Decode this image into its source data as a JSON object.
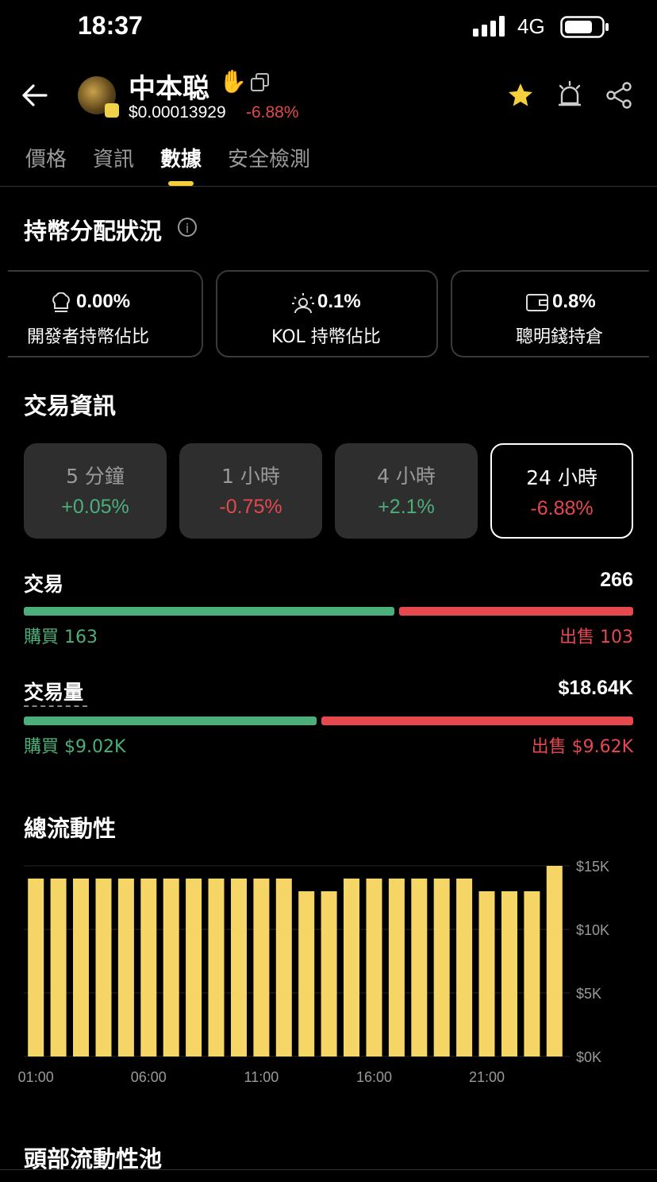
{
  "status_bar": {
    "time": "18:37",
    "network": "4G"
  },
  "header": {
    "token_name": "中本聪",
    "price": "$0.00013929",
    "change": "-6.88%"
  },
  "tabs": [
    {
      "label": "價格"
    },
    {
      "label": "資訊"
    },
    {
      "label": "數據",
      "active": true
    },
    {
      "label": "安全檢測"
    }
  ],
  "holdings": {
    "title": "持幣分配狀況",
    "cards": [
      {
        "icon": "chef-hat-icon",
        "value": "0.00%",
        "label": "開發者持幣佔比"
      },
      {
        "icon": "sun-person-icon",
        "value": "0.1%",
        "label": "KOL 持幣佔比"
      },
      {
        "icon": "wallet-icon",
        "value": "0.8%",
        "label": "聰明錢持倉"
      }
    ]
  },
  "trading": {
    "title": "交易資訊",
    "timeframes": [
      {
        "name": "5 分鐘",
        "value": "+0.05%",
        "dir": "up"
      },
      {
        "name": "1 小時",
        "value": "-0.75%",
        "dir": "down"
      },
      {
        "name": "4 小時",
        "value": "+2.1%",
        "dir": "up"
      },
      {
        "name": "24 小時",
        "value": "-6.88%",
        "dir": "down",
        "selected": true
      }
    ],
    "txns": {
      "label": "交易",
      "total": "266",
      "buy_label": "購買 163",
      "sell_label": "出售 103",
      "buy": 163,
      "sell": 103
    },
    "volume": {
      "label": "交易量",
      "total": "$18.64K",
      "buy_label": "購買 $9.02K",
      "sell_label": "出售 $9.62K",
      "buy": 9.02,
      "sell": 9.62
    }
  },
  "liquidity": {
    "title": "總流動性"
  },
  "top_pools": {
    "title": "頭部流動性池"
  },
  "colors": {
    "accent": "#f5cf3b",
    "green": "#4caf7a",
    "red": "#e5484d",
    "bar": "#f5d565"
  },
  "chart_data": {
    "type": "bar",
    "title": "",
    "x": [
      "01:00",
      "02:00",
      "03:00",
      "04:00",
      "05:00",
      "06:00",
      "07:00",
      "08:00",
      "09:00",
      "10:00",
      "11:00",
      "12:00",
      "13:00",
      "14:00",
      "15:00",
      "16:00",
      "17:00",
      "18:00",
      "19:00",
      "20:00",
      "21:00",
      "22:00",
      "23:00",
      "00:00"
    ],
    "x_tick_labels": [
      "01:00",
      "06:00",
      "11:00",
      "16:00",
      "21:00"
    ],
    "values": [
      14000,
      14000,
      14000,
      14000,
      14000,
      14000,
      14000,
      14000,
      14000,
      14000,
      14000,
      14000,
      13000,
      13000,
      14000,
      14000,
      14000,
      14000,
      14000,
      14000,
      13000,
      13000,
      13000,
      15000
    ],
    "y_ticks": [
      "$15K",
      "$10K",
      "$5K",
      "$0K"
    ],
    "ylim": [
      0,
      15000
    ],
    "grid": true
  }
}
